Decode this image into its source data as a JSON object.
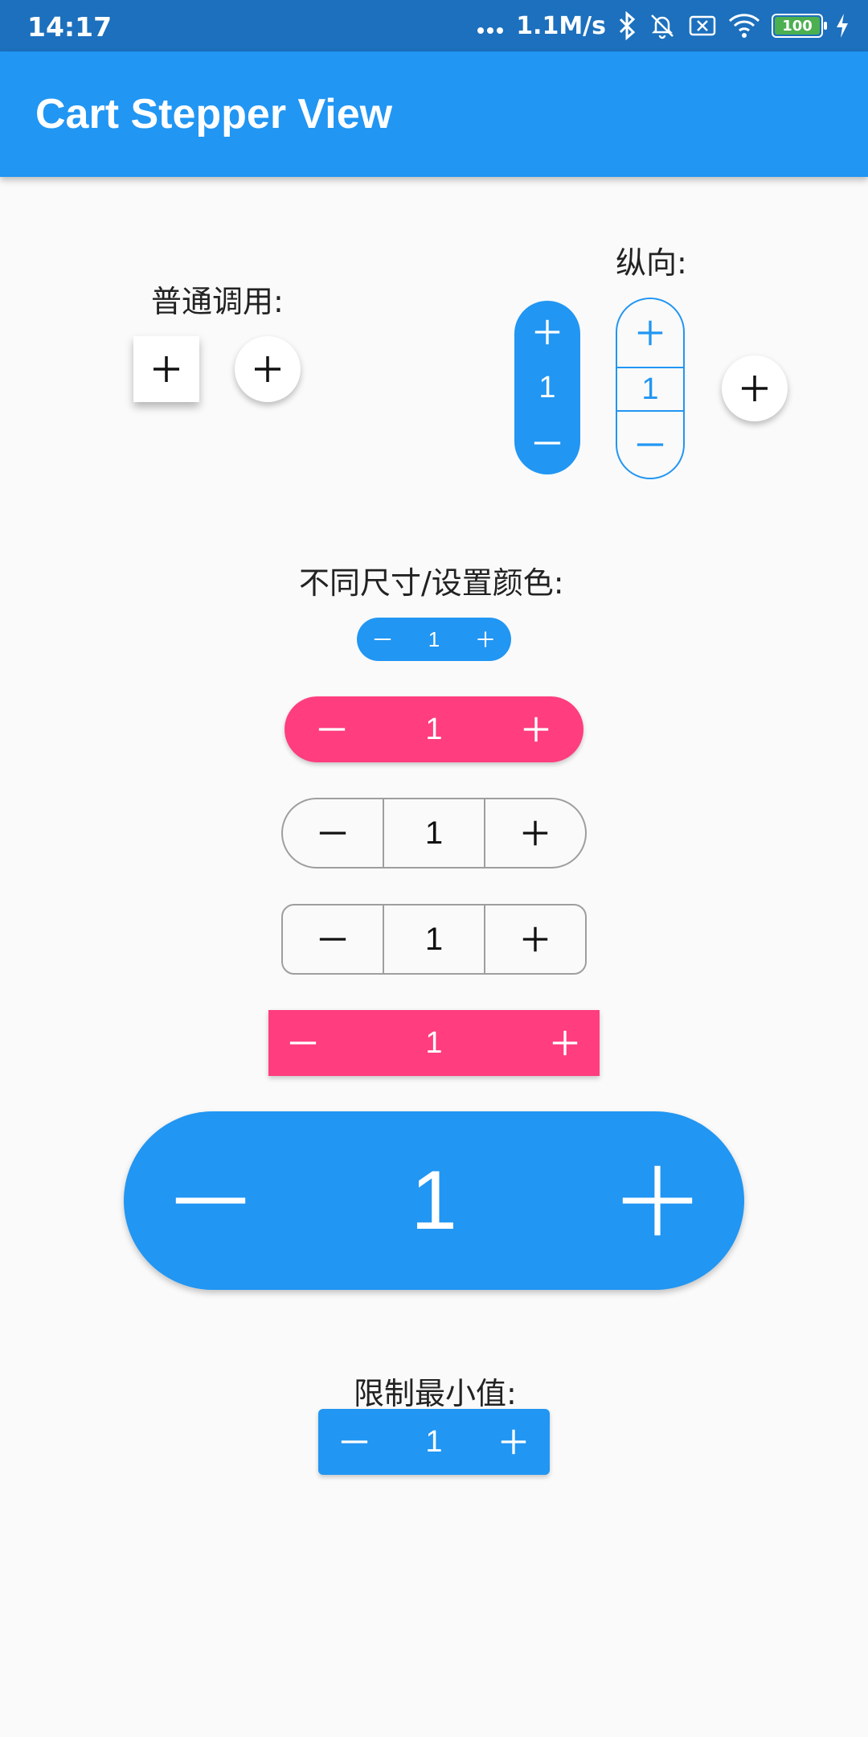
{
  "status_bar": {
    "time": "14:17",
    "network_speed": "1.1M/s",
    "battery": "100",
    "icons": [
      "dots-icon",
      "bluetooth-icon",
      "bell-off-icon",
      "sim-off-icon",
      "wifi-icon",
      "battery-icon",
      "charging-icon"
    ]
  },
  "app_bar": {
    "title": "Cart Stepper View"
  },
  "sections": {
    "normal": {
      "label": "普通调用:"
    },
    "vertical": {
      "label": "纵向:",
      "stepper1_value": "1",
      "stepper2_value": "1"
    },
    "sizes": {
      "label": "不同尺寸/设置颜色:",
      "values": [
        "1",
        "1",
        "1",
        "1",
        "1",
        "1"
      ]
    },
    "limit_min": {
      "label": "限制最小值:",
      "value": "1"
    }
  },
  "colors": {
    "primary": "#2196f3",
    "accent": "#ff3d7f",
    "border_gray": "#9e9e9e",
    "status_bar": "#1c70bd"
  }
}
